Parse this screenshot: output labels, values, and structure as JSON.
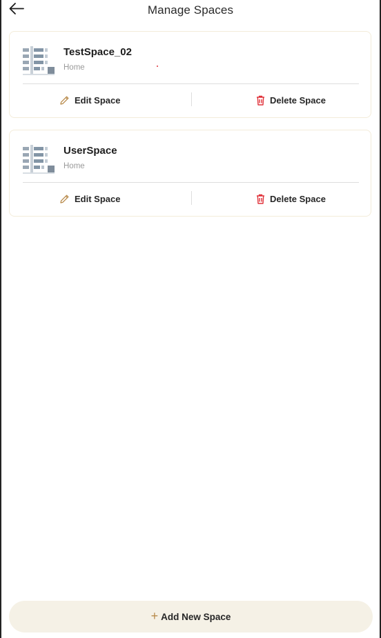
{
  "header": {
    "title": "Manage Spaces",
    "back_icon": "arrow-left-icon"
  },
  "spaces": [
    {
      "name": "TestSpace_02",
      "type": "Home",
      "thumbnail_icon": "building-icon",
      "edit_label": "Edit Space",
      "delete_label": "Delete Space"
    },
    {
      "name": "UserSpace",
      "type": "Home",
      "thumbnail_icon": "building-icon",
      "edit_label": "Edit Space",
      "delete_label": "Delete Space"
    }
  ],
  "footer": {
    "add_label": "Add New Space",
    "add_icon": "plus-icon"
  },
  "colors": {
    "accent": "#b88a4a",
    "delete": "#e0323a",
    "button_bg": "#f5f1e6",
    "card_border": "#f3ecd9"
  }
}
